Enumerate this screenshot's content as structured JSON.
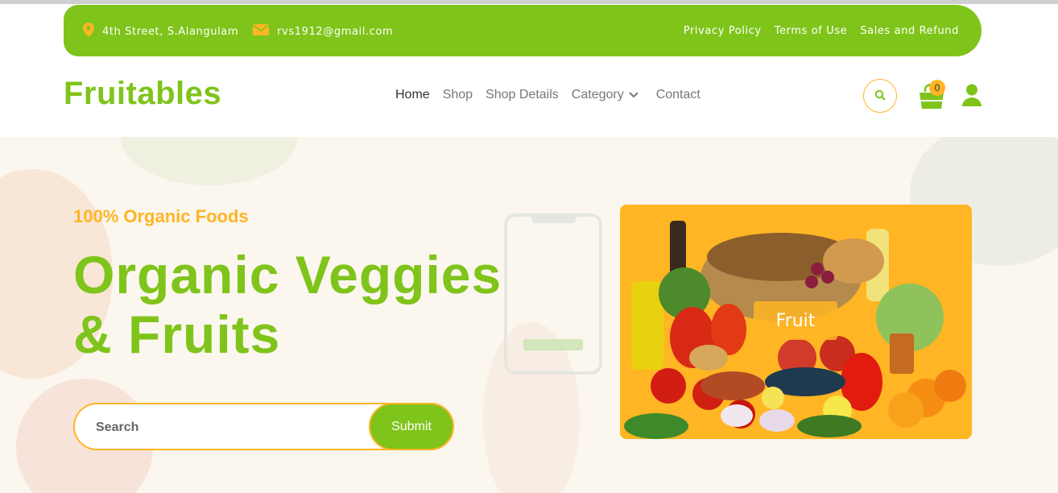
{
  "topbar": {
    "address": "4th Street, S.Alangulam",
    "email": "rvs1912@gmail.com",
    "links": [
      "Privacy Policy",
      "Terms of Use",
      "Sales and Refund"
    ],
    "icons": [
      "location-pin-icon",
      "envelope-icon"
    ]
  },
  "navbar": {
    "brand": "Fruitables",
    "items": [
      "Home",
      "Shop",
      "Shop Details",
      "Category",
      "Contact"
    ],
    "active": "Home",
    "cart_count": "0",
    "icons": [
      "search-icon",
      "shopping-bag-icon",
      "user-icon",
      "chevron-down-icon"
    ]
  },
  "hero": {
    "subtitle": "100% Organic Foods",
    "headline_line1": "Organic Veggies",
    "headline_line2": "& Fruits",
    "search_placeholder": "Search",
    "submit_label": "Submit",
    "card_label": "Fruit"
  },
  "colors": {
    "primary_green": "#7fc41a",
    "accent_orange": "#ffb524",
    "hero_bg": "#fbf6ee"
  }
}
